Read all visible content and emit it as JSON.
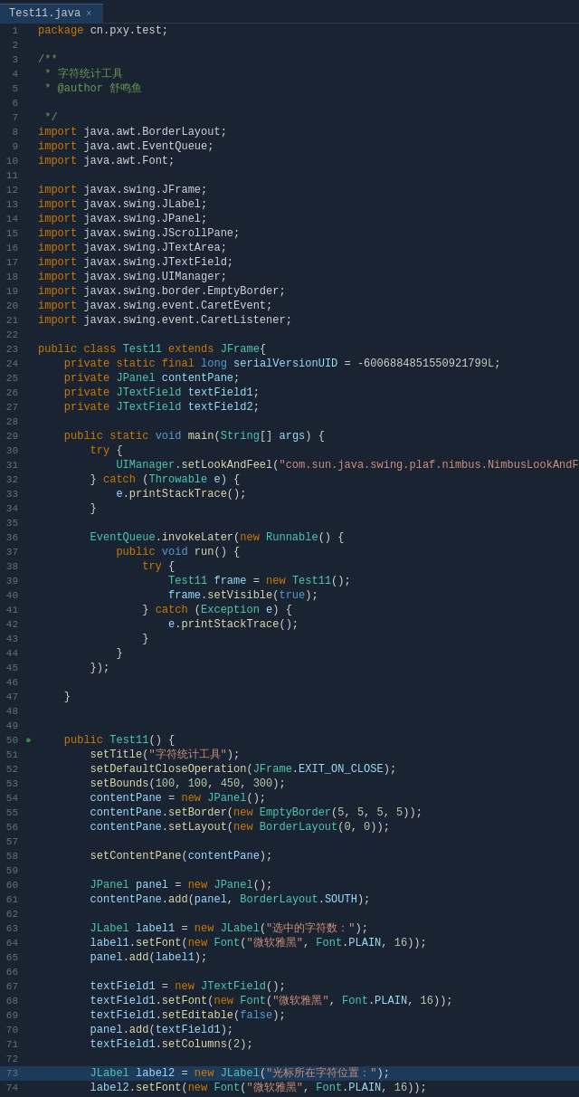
{
  "tab": {
    "label": "Test11.java",
    "close": "×"
  },
  "title": "Test11.java",
  "lines": []
}
